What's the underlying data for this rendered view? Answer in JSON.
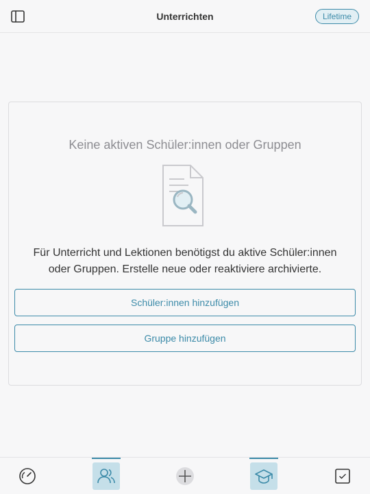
{
  "header": {
    "title": "Unterrichten",
    "badge": "Lifetime"
  },
  "empty_state": {
    "title": "Keine aktiven Schüler:innen oder Gruppen",
    "description": "Für Unterricht und Lektionen benötigst du aktive Schüler:innen oder Gruppen. Erstelle neue oder reaktiviere archivierte.",
    "add_students_label": "Schüler:innen hinzufügen",
    "add_group_label": "Gruppe hinzufügen",
    "icon": "document-search-icon"
  },
  "tabbar": {
    "tabs": [
      {
        "icon": "dashboard-gauge-icon",
        "active": false
      },
      {
        "icon": "students-icon",
        "active": true
      },
      {
        "icon": "plus-icon",
        "active": false
      },
      {
        "icon": "teach-graduation-cap-icon",
        "active": true
      },
      {
        "icon": "checkbox-tasks-icon",
        "active": false
      }
    ]
  },
  "colors": {
    "accent": "#3b8aa8",
    "accent_light": "#c5dfe9",
    "background": "#f7f7f8",
    "muted_text": "#8d8d92"
  }
}
